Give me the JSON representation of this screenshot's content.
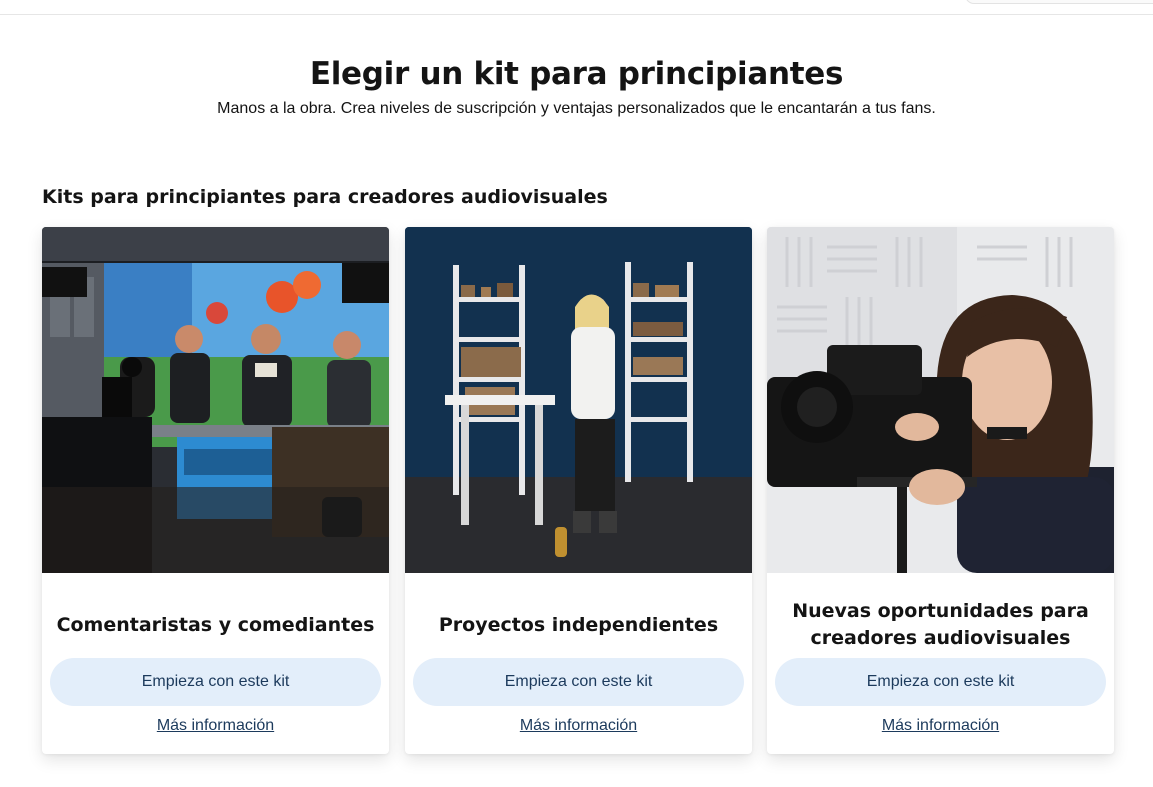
{
  "page": {
    "title": "Elegir un kit para principiantes",
    "subtitle": "Manos a la obra. Crea niveles de suscripción y ventajas personalizados que le encantarán a tus fans."
  },
  "section": {
    "title": "Kits para principiantes para creadores audiovisuales"
  },
  "cards": [
    {
      "title": "Comentaristas y comediantes",
      "button_label": "Empieza con este kit",
      "link_label": "Más información",
      "image": "podcast-studio-photo"
    },
    {
      "title": "Proyectos independientes",
      "button_label": "Empieza con este kit",
      "link_label": "Más información",
      "image": "miniatures-studio-photo"
    },
    {
      "title": "Nuevas oportunidades para creadores audiovisuales",
      "button_label": "Empieza con este kit",
      "link_label": "Más información",
      "image": "camera-operator-photo"
    }
  ],
  "colors": {
    "button_bg": "#e3eefa",
    "button_text": "#1c3a5c",
    "link": "#1c3a5c",
    "text": "#141414"
  }
}
